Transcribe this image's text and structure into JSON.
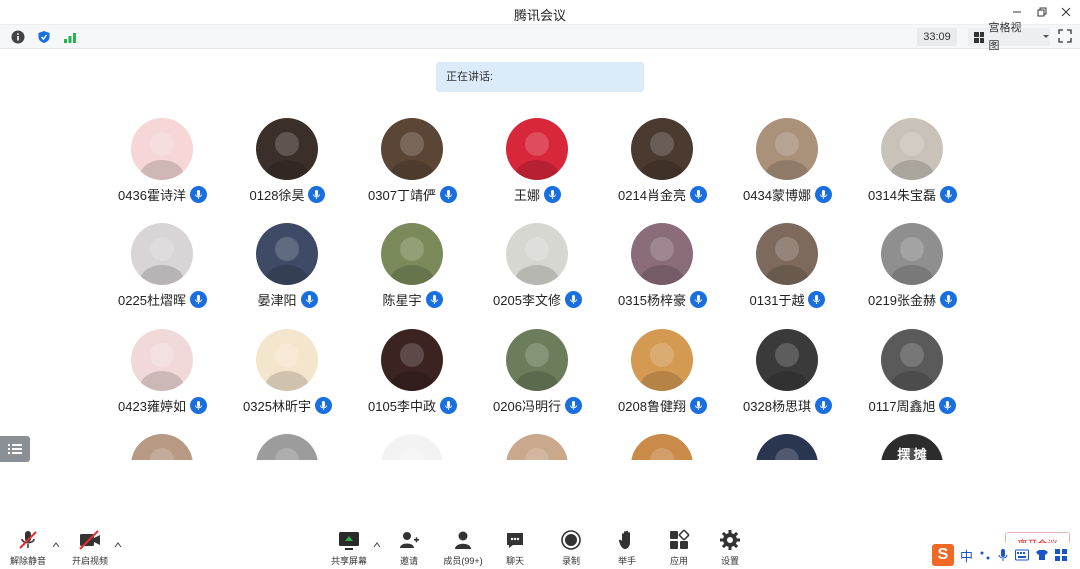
{
  "window": {
    "title": "腾讯会议"
  },
  "toolbar": {
    "timer": "33:09",
    "view_mode": "宫格视图"
  },
  "speaking": {
    "label": "正在讲话:"
  },
  "participants": [
    {
      "name": "0436霍诗洋",
      "bg": "#f6d6d6"
    },
    {
      "name": "0128徐昊",
      "bg": "#3b2f2a"
    },
    {
      "name": "0307丁靖俨",
      "bg": "#5b4636"
    },
    {
      "name": "王娜",
      "bg": "#d8263a"
    },
    {
      "name": "0214肖金亮",
      "bg": "#4a3a30"
    },
    {
      "name": "0434蒙博娜",
      "bg": "#a9917a"
    },
    {
      "name": "0314朱宝磊",
      "bg": "#c8c2b8"
    },
    {
      "name": "0225杜熠晖",
      "bg": "#d9d4d6"
    },
    {
      "name": "晏津阳",
      "bg": "#3e4a66"
    },
    {
      "name": "陈星宇",
      "bg": "#7a8a5a"
    },
    {
      "name": "0205李文修",
      "bg": "#d7d7d2"
    },
    {
      "name": "0315杨梓豪",
      "bg": "#8a6c7a"
    },
    {
      "name": "0131于越",
      "bg": "#7d6a5c"
    },
    {
      "name": "0219张金赫",
      "bg": "#8f8f8f"
    },
    {
      "name": "0423雍婷如",
      "bg": "#f1d9d9"
    },
    {
      "name": "0325林昕宇",
      "bg": "#f4e6cc"
    },
    {
      "name": "0105李中政",
      "bg": "#3a2320"
    },
    {
      "name": "0206冯明行",
      "bg": "#6b7d5a"
    },
    {
      "name": "0208鲁健翔",
      "bg": "#d49a52"
    },
    {
      "name": "0328杨思琪",
      "bg": "#3a3a3a"
    },
    {
      "name": "0117周鑫旭",
      "bg": "#5a5a5a"
    },
    {
      "name": "",
      "bg": "#b89a84"
    },
    {
      "name": "",
      "bg": "#9c9c9c"
    },
    {
      "name": "",
      "bg": "#f3f3f3"
    },
    {
      "name": "",
      "bg": "#c9a88c"
    },
    {
      "name": "",
      "bg": "#c98a4a"
    },
    {
      "name": "",
      "bg": "#2a3550"
    },
    {
      "name": "",
      "bg": "#2c2c2c"
    }
  ],
  "partial_row_text": {
    "last_avatar": "摆 摊"
  },
  "bottom": {
    "unmute": "解除静音",
    "start_video": "开启视频",
    "share_screen": "共享屏幕",
    "invite": "邀请",
    "members": "成员(99+)",
    "chat": "聊天",
    "record": "录制",
    "raise_hand": "举手",
    "apps": "应用",
    "settings": "设置",
    "leave": "离开会议"
  },
  "ime": {
    "mode": "中"
  }
}
